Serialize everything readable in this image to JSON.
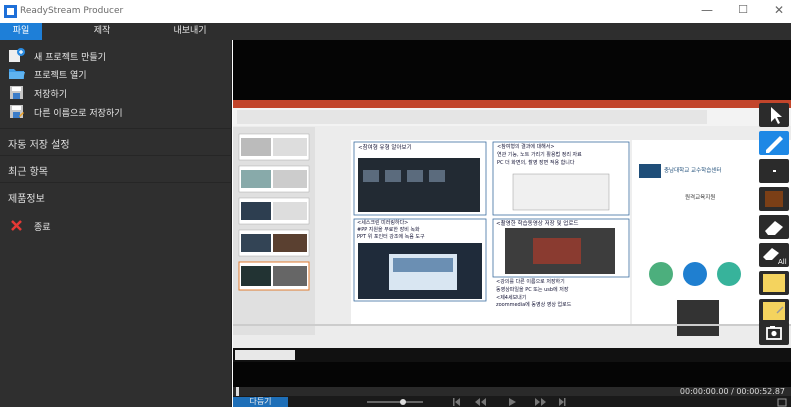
{
  "window": {
    "title": "ReadyStream Producer",
    "minimize_icon": "minimize-icon",
    "maximize_icon": "maximize-icon",
    "close_icon": "close-icon"
  },
  "menu": {
    "tabs": [
      {
        "label": "파일",
        "active": true
      },
      {
        "label": "제작",
        "active": false
      },
      {
        "label": "내보내기",
        "active": false
      }
    ]
  },
  "sidebar": {
    "items": [
      {
        "label": "새 프로젝트 만들기",
        "icon": "new-project-icon"
      },
      {
        "label": "프로젝트 열기",
        "icon": "folder-open-icon"
      },
      {
        "label": "저장하기",
        "icon": "save-icon"
      },
      {
        "label": "다른 이름으로 저장하기",
        "icon": "save-as-icon"
      }
    ],
    "sections": [
      {
        "label": "자동 저장 설정"
      },
      {
        "label": "최근 항목"
      },
      {
        "label": "제품정보"
      }
    ],
    "exit_label": "종료"
  },
  "slide_preview": {
    "box1_title": "<참여형 유형 알아보기",
    "box2_line1": "<참여형의 결과에 대해서>",
    "box2_line2": "연관 기능, 노트 가리기 활용법 정리 자료",
    "box2_line3": "PC 더 화면의, 촬영 장면 적용 합니다",
    "box3_line1": "<세스크린 미러링하다>",
    "box3_line2": "#PP 지원을 무료한 장비 녹화",
    "box3_line3": "PPT 위 포인터 강조에 녹음 도구",
    "box4_title": "<촬영한 학습동영상 저장 및 업로드",
    "box5_line1": "<강의를 다른 이름으로 저장하기",
    "box5_line2": "동영상파일을 PC 또는 usb에 저장",
    "box5_line3": "<제4세보내기",
    "box5_line4": "zoommedia에 동영상 영상 업로드",
    "brand": "충남대학교 교수학습센터",
    "slide_heading": "원격교육지원"
  },
  "tools": [
    {
      "name": "pointer-icon",
      "color": "#ffffff"
    },
    {
      "name": "pen-icon",
      "color": "#1e88e5"
    },
    {
      "name": "dot-icon",
      "color": "#ffffff"
    },
    {
      "name": "brown-color-swatch",
      "color": "#7b3f16"
    },
    {
      "name": "eraser-icon",
      "color": "#ffffff"
    },
    {
      "name": "eraser-all-icon",
      "color": "#ffffff"
    },
    {
      "name": "yellow-color-swatch",
      "color": "#f4d35e"
    },
    {
      "name": "yellow-note-icon",
      "color": "#f4d35e"
    },
    {
      "name": "camera-icon",
      "color": "#ffffff"
    }
  ],
  "player": {
    "timecode": "00:00:00.00 / 00:00:52.87",
    "prev_label": "다듬기"
  }
}
